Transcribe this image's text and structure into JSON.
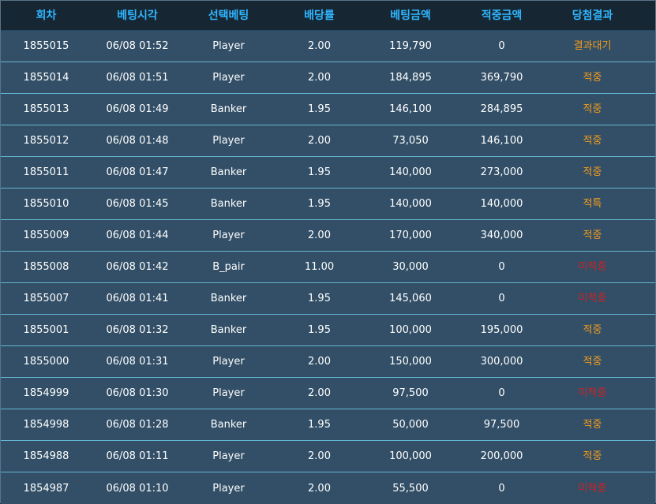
{
  "table": {
    "headers": [
      "회차",
      "베팅시각",
      "선택베팅",
      "배당률",
      "베팅금액",
      "적중금액",
      "당첨결과"
    ],
    "rows": [
      [
        "1855015",
        "06/08 01:52",
        "Player",
        "2.00",
        "119,790",
        "0",
        "결과대기"
      ],
      [
        "1855014",
        "06/08 01:51",
        "Player",
        "2.00",
        "184,895",
        "369,790",
        "적중"
      ],
      [
        "1855013",
        "06/08 01:49",
        "Banker",
        "1.95",
        "146,100",
        "284,895",
        "적중"
      ],
      [
        "1855012",
        "06/08 01:48",
        "Player",
        "2.00",
        "73,050",
        "146,100",
        "적중"
      ],
      [
        "1855011",
        "06/08 01:47",
        "Banker",
        "1.95",
        "140,000",
        "273,000",
        "적중"
      ],
      [
        "1855010",
        "06/08 01:45",
        "Banker",
        "1.95",
        "140,000",
        "140,000",
        "적특"
      ],
      [
        "1855009",
        "06/08 01:44",
        "Player",
        "2.00",
        "170,000",
        "340,000",
        "적중"
      ],
      [
        "1855008",
        "06/08 01:42",
        "B_pair",
        "11.00",
        "30,000",
        "0",
        "미적중"
      ],
      [
        "1855007",
        "06/08 01:41",
        "Banker",
        "1.95",
        "145,060",
        "0",
        "미적중"
      ],
      [
        "1855001",
        "06/08 01:32",
        "Banker",
        "1.95",
        "100,000",
        "195,000",
        "적중"
      ],
      [
        "1855000",
        "06/08 01:31",
        "Player",
        "2.00",
        "150,000",
        "300,000",
        "적중"
      ],
      [
        "1854999",
        "06/08 01:30",
        "Player",
        "2.00",
        "97,500",
        "0",
        "미적중"
      ],
      [
        "1854998",
        "06/08 01:28",
        "Banker",
        "1.95",
        "50,000",
        "97,500",
        "적중"
      ],
      [
        "1854988",
        "06/08 01:11",
        "Player",
        "2.00",
        "100,000",
        "200,000",
        "적중"
      ],
      [
        "1854987",
        "06/08 01:10",
        "Player",
        "2.00",
        "55,500",
        "0",
        "미적중"
      ]
    ]
  },
  "colors": {
    "header_bg": "#172633",
    "header_text": "#2fb6ff",
    "row_bg": "#324f67",
    "row_border": "#64b6d0",
    "status_orange": "#f39b1c",
    "status_red": "#c91f1f"
  }
}
